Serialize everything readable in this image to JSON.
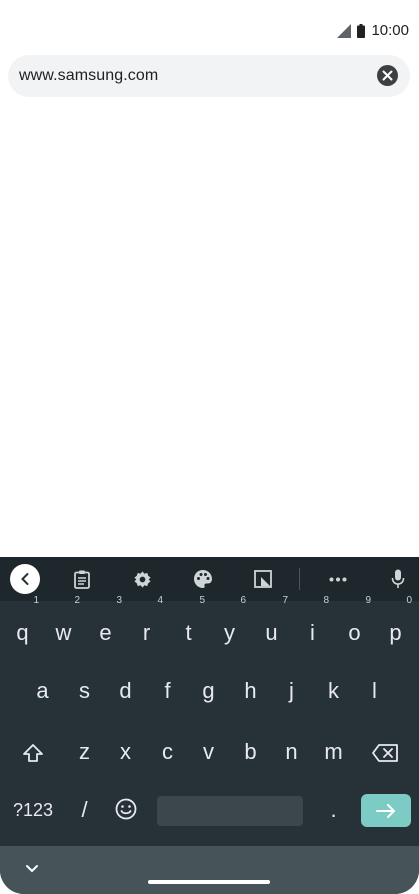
{
  "status_bar": {
    "time": "10:00",
    "icons": [
      "signal-icon",
      "battery-icon"
    ]
  },
  "browser": {
    "url_value": "www.samsung.com",
    "clear_icon": "clear-icon"
  },
  "keyboard": {
    "toolbar_icons": [
      "back-icon",
      "clipboard-icon",
      "settings-icon",
      "palette-icon",
      "resize-icon",
      "more-icon",
      "mic-icon"
    ],
    "row1": [
      {
        "key": "q",
        "hint": "1"
      },
      {
        "key": "w",
        "hint": "2"
      },
      {
        "key": "e",
        "hint": "3"
      },
      {
        "key": "r",
        "hint": "4"
      },
      {
        "key": "t",
        "hint": "5"
      },
      {
        "key": "y",
        "hint": "6"
      },
      {
        "key": "u",
        "hint": "7"
      },
      {
        "key": "i",
        "hint": "8"
      },
      {
        "key": "o",
        "hint": "9"
      },
      {
        "key": "p",
        "hint": "0"
      }
    ],
    "row2": [
      "a",
      "s",
      "d",
      "f",
      "g",
      "h",
      "j",
      "k",
      "l"
    ],
    "row3": [
      "z",
      "x",
      "c",
      "v",
      "b",
      "n",
      "m"
    ],
    "symbols_label": "?123",
    "slash_label": "/",
    "period_label": ".",
    "colors": {
      "keyboard_bg": "#263238",
      "toolbar_bg": "#1e272c",
      "enter_accent": "#7ccbc4"
    }
  }
}
